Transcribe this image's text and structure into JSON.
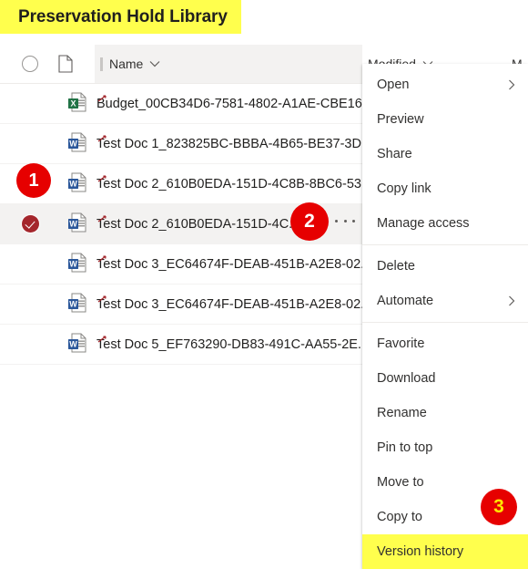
{
  "header": {
    "title": "Preservation Hold Library",
    "title_highlight_color": "#ffff4d"
  },
  "columns": {
    "select_all_icon": "circle-icon",
    "filetype_icon": "document-icon",
    "name_label": "Name",
    "modified_label": "Modified",
    "modified_by_label": "M",
    "sort_chevron_icon": "chevron-down-icon"
  },
  "files": [
    {
      "name": "Budget_00CB34D6-7581-4802-A1AE-CBE16...",
      "icon": "excel-file-icon",
      "selected": false,
      "new_mark": true
    },
    {
      "name": "Test Doc 1_823825BC-BBBA-4B65-BE37-3D...",
      "icon": "word-file-icon",
      "selected": false,
      "new_mark": true
    },
    {
      "name": "Test Doc 2_610B0EDA-151D-4C8B-8BC6-53...",
      "icon": "word-file-icon",
      "selected": false,
      "new_mark": true
    },
    {
      "name": "Test Doc 2_610B0EDA-151D-4C...",
      "icon": "word-file-icon",
      "selected": true,
      "new_mark": true
    },
    {
      "name": "Test Doc 3_EC64674F-DEAB-451B-A2E8-02...",
      "icon": "word-file-icon",
      "selected": false,
      "new_mark": true
    },
    {
      "name": "Test Doc 3_EC64674F-DEAB-451B-A2E8-02...",
      "icon": "word-file-icon",
      "selected": false,
      "new_mark": true
    },
    {
      "name": "Test Doc 5_EF763290-DB83-491C-AA55-2E...",
      "icon": "word-file-icon",
      "selected": false,
      "new_mark": true
    }
  ],
  "row_more_icon": "ellipsis-icon",
  "context_menu": {
    "items": [
      {
        "label": "Open",
        "submenu": true,
        "separator_after": false,
        "highlighted": false
      },
      {
        "label": "Preview",
        "submenu": false,
        "separator_after": false,
        "highlighted": false
      },
      {
        "label": "Share",
        "submenu": false,
        "separator_after": false,
        "highlighted": false
      },
      {
        "label": "Copy link",
        "submenu": false,
        "separator_after": false,
        "highlighted": false
      },
      {
        "label": "Manage access",
        "submenu": false,
        "separator_after": true,
        "highlighted": false
      },
      {
        "label": "Delete",
        "submenu": false,
        "separator_after": false,
        "highlighted": false
      },
      {
        "label": "Automate",
        "submenu": true,
        "separator_after": true,
        "highlighted": false
      },
      {
        "label": "Favorite",
        "submenu": false,
        "separator_after": false,
        "highlighted": false
      },
      {
        "label": "Download",
        "submenu": false,
        "separator_after": false,
        "highlighted": false
      },
      {
        "label": "Rename",
        "submenu": false,
        "separator_after": false,
        "highlighted": false
      },
      {
        "label": "Pin to top",
        "submenu": false,
        "separator_after": false,
        "highlighted": false
      },
      {
        "label": "Move to",
        "submenu": false,
        "separator_after": false,
        "highlighted": false
      },
      {
        "label": "Copy to",
        "submenu": false,
        "separator_after": false,
        "highlighted": false
      },
      {
        "label": "Version history",
        "submenu": false,
        "separator_after": false,
        "highlighted": true
      }
    ]
  },
  "annotations": [
    {
      "number": "1",
      "color": "#e60000",
      "text_color": "#ffffff"
    },
    {
      "number": "2",
      "color": "#e60000",
      "text_color": "#ffffff"
    },
    {
      "number": "3",
      "color": "#e60000",
      "text_color": "#ffe600"
    }
  ]
}
